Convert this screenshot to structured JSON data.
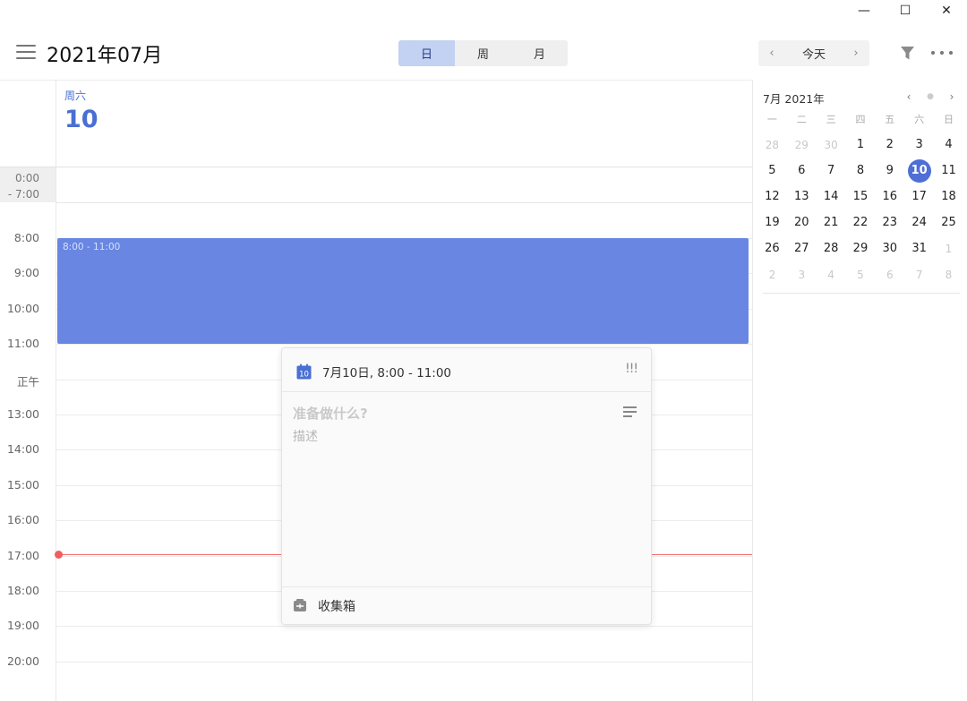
{
  "window": {
    "minimize": "—",
    "maximize": "☐",
    "close": "✕"
  },
  "header": {
    "month_title": "2021年07月",
    "views": [
      {
        "label": "日",
        "active": true
      },
      {
        "label": "周",
        "active": false
      },
      {
        "label": "月",
        "active": false
      }
    ],
    "nav": {
      "prev": "‹",
      "today": "今天",
      "next": "›"
    },
    "icons": {
      "menu": "hamburger-icon",
      "filter": "filter-icon",
      "more": "more-icon"
    }
  },
  "day_view": {
    "weekday": "周六",
    "day": "10",
    "collapsed_range": [
      "0:00",
      "- 7:00"
    ],
    "hours": [
      "8:00",
      "9:00",
      "10:00",
      "11:00",
      "正午",
      "13:00",
      "14:00",
      "15:00",
      "16:00",
      "17:00",
      "18:00",
      "19:00",
      "20:00"
    ],
    "event": {
      "time": "8:00 - 11:00",
      "color": "#6886e2"
    },
    "now_color": "#ef5d5d"
  },
  "popup": {
    "calendar_icon_day": "10",
    "date_range": "7月10日, 8:00 - 11:00",
    "priority": "!!!",
    "title_placeholder": "准备做什么?",
    "desc_placeholder": "描述",
    "list_name": "收集箱"
  },
  "mini_calendar": {
    "title": "7月 2021年",
    "nav_prev": "‹",
    "nav_dot": "●",
    "nav_next": "›",
    "weekdays": [
      "一",
      "二",
      "三",
      "四",
      "五",
      "六",
      "日"
    ],
    "weeks": [
      [
        {
          "d": "28",
          "dim": true
        },
        {
          "d": "29",
          "dim": true
        },
        {
          "d": "30",
          "dim": true
        },
        {
          "d": "1"
        },
        {
          "d": "2"
        },
        {
          "d": "3"
        },
        {
          "d": "4"
        }
      ],
      [
        {
          "d": "5"
        },
        {
          "d": "6"
        },
        {
          "d": "7"
        },
        {
          "d": "8"
        },
        {
          "d": "9"
        },
        {
          "d": "10",
          "selected": true
        },
        {
          "d": "11"
        }
      ],
      [
        {
          "d": "12"
        },
        {
          "d": "13"
        },
        {
          "d": "14"
        },
        {
          "d": "15"
        },
        {
          "d": "16"
        },
        {
          "d": "17"
        },
        {
          "d": "18"
        }
      ],
      [
        {
          "d": "19"
        },
        {
          "d": "20"
        },
        {
          "d": "21"
        },
        {
          "d": "22"
        },
        {
          "d": "23"
        },
        {
          "d": "24"
        },
        {
          "d": "25"
        }
      ],
      [
        {
          "d": "26"
        },
        {
          "d": "27"
        },
        {
          "d": "28"
        },
        {
          "d": "29"
        },
        {
          "d": "30"
        },
        {
          "d": "31"
        },
        {
          "d": "1",
          "dim": true
        }
      ],
      [
        {
          "d": "2",
          "dim": true
        },
        {
          "d": "3",
          "dim": true
        },
        {
          "d": "4",
          "dim": true
        },
        {
          "d": "5",
          "dim": true
        },
        {
          "d": "6",
          "dim": true
        },
        {
          "d": "7",
          "dim": true
        },
        {
          "d": "8",
          "dim": true
        }
      ]
    ],
    "accent": "#4f6fd6"
  }
}
